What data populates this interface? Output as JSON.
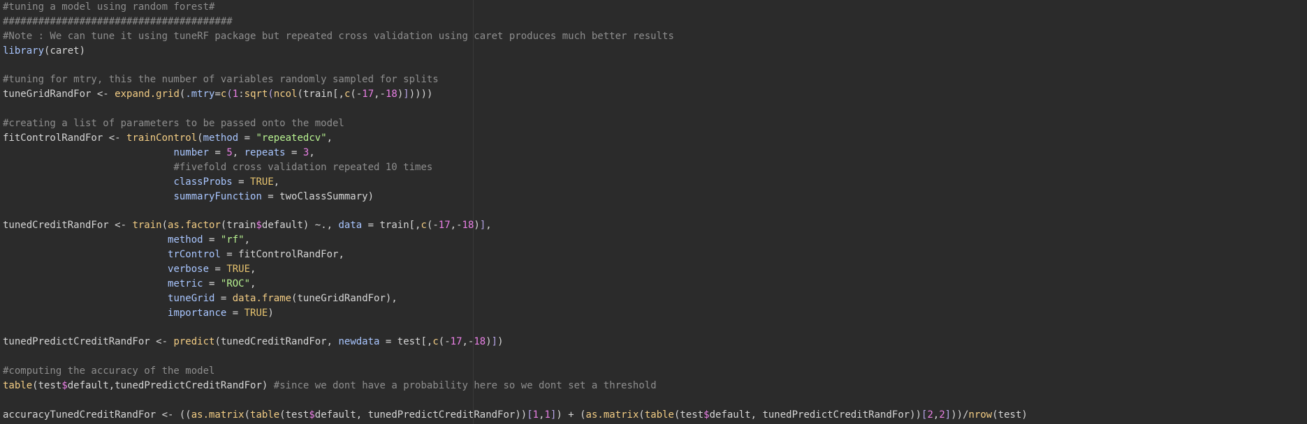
{
  "editor": {
    "lines": [
      [
        {
          "t": "#tuning a model using random forest#",
          "c": "comment"
        }
      ],
      [
        {
          "t": "#######################################",
          "c": "comment"
        }
      ],
      [
        {
          "t": "#Note : We can tune it using tuneRF package but repeated cross validation using caret produces much better results",
          "c": "comment"
        }
      ],
      [
        {
          "t": "library",
          "c": "arg"
        },
        {
          "t": "(caret)",
          "c": "op"
        }
      ],
      [],
      [
        {
          "t": "#tuning for mtry, this the number of variables randomly sampled for splits",
          "c": "comment"
        }
      ],
      [
        {
          "t": "tuneGridRandFor <- ",
          "c": "op"
        },
        {
          "t": "expand.grid",
          "c": "fn"
        },
        {
          "t": "(",
          "c": "op"
        },
        {
          "t": ".mtry",
          "c": "arg"
        },
        {
          "t": "=",
          "c": "op"
        },
        {
          "t": "c",
          "c": "fn"
        },
        {
          "t": "(",
          "c": "paren"
        },
        {
          "t": "1",
          "c": "num"
        },
        {
          "t": ":",
          "c": "op"
        },
        {
          "t": "sqrt",
          "c": "fn"
        },
        {
          "t": "(",
          "c": "paren"
        },
        {
          "t": "ncol",
          "c": "fn"
        },
        {
          "t": "(train[,",
          "c": "op"
        },
        {
          "t": "c",
          "c": "fn"
        },
        {
          "t": "(-",
          "c": "op"
        },
        {
          "t": "17",
          "c": "num"
        },
        {
          "t": ",-",
          "c": "op"
        },
        {
          "t": "18",
          "c": "num"
        },
        {
          "t": ")",
          "c": "op"
        },
        {
          "t": "]",
          "c": "paren"
        },
        {
          "t": "))))",
          "c": "op"
        }
      ],
      [],
      [
        {
          "t": "#creating a list of parameters to be passed onto the model",
          "c": "comment"
        }
      ],
      [
        {
          "t": "fitControlRandFor <- ",
          "c": "op"
        },
        {
          "t": "trainControl",
          "c": "fn"
        },
        {
          "t": "(",
          "c": "op"
        },
        {
          "t": "method",
          "c": "arg"
        },
        {
          "t": " = ",
          "c": "op"
        },
        {
          "t": "\"repeatedcv\"",
          "c": "str"
        },
        {
          "t": ",",
          "c": "op"
        }
      ],
      [
        {
          "t": "                             ",
          "c": "op"
        },
        {
          "t": "number",
          "c": "arg"
        },
        {
          "t": " = ",
          "c": "op"
        },
        {
          "t": "5",
          "c": "num"
        },
        {
          "t": ", ",
          "c": "op"
        },
        {
          "t": "repeats",
          "c": "arg"
        },
        {
          "t": " = ",
          "c": "op"
        },
        {
          "t": "3",
          "c": "num"
        },
        {
          "t": ",",
          "c": "op"
        }
      ],
      [
        {
          "t": "                             ",
          "c": "op"
        },
        {
          "t": "#fivefold cross validation repeated 10 times",
          "c": "comment"
        }
      ],
      [
        {
          "t": "                             ",
          "c": "op"
        },
        {
          "t": "classProbs",
          "c": "arg"
        },
        {
          "t": " = ",
          "c": "op"
        },
        {
          "t": "TRUE",
          "c": "const"
        },
        {
          "t": ",",
          "c": "op"
        }
      ],
      [
        {
          "t": "                             ",
          "c": "op"
        },
        {
          "t": "summaryFunction",
          "c": "arg"
        },
        {
          "t": " = twoClassSummary)",
          "c": "op"
        }
      ],
      [],
      [
        {
          "t": "tunedCreditRandFor <- ",
          "c": "op"
        },
        {
          "t": "train",
          "c": "fn"
        },
        {
          "t": "(",
          "c": "op"
        },
        {
          "t": "as.factor",
          "c": "fn"
        },
        {
          "t": "(train",
          "c": "op"
        },
        {
          "t": "$",
          "c": "dollar"
        },
        {
          "t": "default) ~., ",
          "c": "op"
        },
        {
          "t": "data",
          "c": "arg"
        },
        {
          "t": " = train[,",
          "c": "op"
        },
        {
          "t": "c",
          "c": "fn"
        },
        {
          "t": "(-",
          "c": "op"
        },
        {
          "t": "17",
          "c": "num"
        },
        {
          "t": ",-",
          "c": "op"
        },
        {
          "t": "18",
          "c": "num"
        },
        {
          "t": ")",
          "c": "op"
        },
        {
          "t": "]",
          "c": "paren"
        },
        {
          "t": ",",
          "c": "op"
        }
      ],
      [
        {
          "t": "                            ",
          "c": "op"
        },
        {
          "t": "method",
          "c": "arg"
        },
        {
          "t": " = ",
          "c": "op"
        },
        {
          "t": "\"rf\"",
          "c": "str"
        },
        {
          "t": ",",
          "c": "op"
        }
      ],
      [
        {
          "t": "                            ",
          "c": "op"
        },
        {
          "t": "trControl",
          "c": "arg"
        },
        {
          "t": " = fitControlRandFor,",
          "c": "op"
        }
      ],
      [
        {
          "t": "                            ",
          "c": "op"
        },
        {
          "t": "verbose",
          "c": "arg"
        },
        {
          "t": " = ",
          "c": "op"
        },
        {
          "t": "TRUE",
          "c": "const"
        },
        {
          "t": ",",
          "c": "op"
        }
      ],
      [
        {
          "t": "                            ",
          "c": "op"
        },
        {
          "t": "metric",
          "c": "arg"
        },
        {
          "t": " = ",
          "c": "op"
        },
        {
          "t": "\"ROC\"",
          "c": "str"
        },
        {
          "t": ",",
          "c": "op"
        }
      ],
      [
        {
          "t": "                            ",
          "c": "op"
        },
        {
          "t": "tuneGrid",
          "c": "arg"
        },
        {
          "t": " = ",
          "c": "op"
        },
        {
          "t": "data.frame",
          "c": "fn"
        },
        {
          "t": "(tuneGridRandFor),",
          "c": "op"
        }
      ],
      [
        {
          "t": "                            ",
          "c": "op"
        },
        {
          "t": "importance",
          "c": "arg"
        },
        {
          "t": " = ",
          "c": "op"
        },
        {
          "t": "TRUE",
          "c": "const"
        },
        {
          "t": ")",
          "c": "op"
        }
      ],
      [],
      [
        {
          "t": "tunedPredictCreditRandFor <- ",
          "c": "op"
        },
        {
          "t": "predict",
          "c": "fn"
        },
        {
          "t": "(tunedCreditRandFor, ",
          "c": "op"
        },
        {
          "t": "newdata",
          "c": "arg"
        },
        {
          "t": " = test[,",
          "c": "op"
        },
        {
          "t": "c",
          "c": "fn"
        },
        {
          "t": "(-",
          "c": "op"
        },
        {
          "t": "17",
          "c": "num"
        },
        {
          "t": ",-",
          "c": "op"
        },
        {
          "t": "18",
          "c": "num"
        },
        {
          "t": ")",
          "c": "op"
        },
        {
          "t": "]",
          "c": "paren"
        },
        {
          "t": ")",
          "c": "op"
        }
      ],
      [],
      [
        {
          "t": "#computing the accuracy of the model",
          "c": "comment"
        }
      ],
      [
        {
          "t": "table",
          "c": "fn"
        },
        {
          "t": "(test",
          "c": "op"
        },
        {
          "t": "$",
          "c": "dollar"
        },
        {
          "t": "default,tunedPredictCreditRandFor) ",
          "c": "op"
        },
        {
          "t": "#since we dont have a probability here so we dont set a threshold",
          "c": "comment"
        }
      ],
      [],
      [
        {
          "t": "accuracyTunedCreditRandFor <- ((",
          "c": "op"
        },
        {
          "t": "as.matrix",
          "c": "fn"
        },
        {
          "t": "(",
          "c": "op"
        },
        {
          "t": "table",
          "c": "fn"
        },
        {
          "t": "(test",
          "c": "op"
        },
        {
          "t": "$",
          "c": "dollar"
        },
        {
          "t": "default, tunedPredictCreditRandFor))",
          "c": "op"
        },
        {
          "t": "[",
          "c": "paren"
        },
        {
          "t": "1",
          "c": "num"
        },
        {
          "t": ",",
          "c": "op"
        },
        {
          "t": "1",
          "c": "num"
        },
        {
          "t": "]",
          "c": "paren"
        },
        {
          "t": ") + (",
          "c": "op"
        },
        {
          "t": "as.matrix",
          "c": "fn"
        },
        {
          "t": "(",
          "c": "op"
        },
        {
          "t": "table",
          "c": "fn"
        },
        {
          "t": "(test",
          "c": "op"
        },
        {
          "t": "$",
          "c": "dollar"
        },
        {
          "t": "default, tunedPredictCreditRandFor))",
          "c": "op"
        },
        {
          "t": "[",
          "c": "paren"
        },
        {
          "t": "2",
          "c": "num"
        },
        {
          "t": ",",
          "c": "op"
        },
        {
          "t": "2",
          "c": "num"
        },
        {
          "t": "]",
          "c": "paren"
        },
        {
          "t": "))/",
          "c": "op"
        },
        {
          "t": "nrow",
          "c": "fn"
        },
        {
          "t": "(test)",
          "c": "op"
        }
      ]
    ]
  }
}
